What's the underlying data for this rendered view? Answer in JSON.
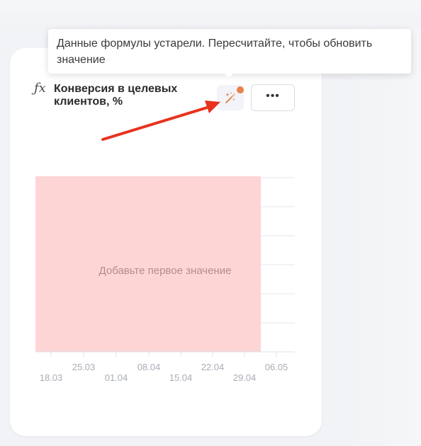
{
  "tooltip": {
    "text": "Данные формулы устарели. Пересчитайте, чтобы обновить значение"
  },
  "card": {
    "title": "Конверсия в целевых клиентов, %",
    "fx_icon": "fx-icon",
    "formula_icon": "magic-wand-icon",
    "more_label": "•••",
    "stale_color": "#e9824a"
  },
  "chart_data": {
    "type": "bar",
    "placeholder": "Добавьте первое значение",
    "x_ticks_upper": [
      "25.03",
      "08.04",
      "22.04",
      "06.05"
    ],
    "x_ticks_lower": [
      "18.03",
      "01.04",
      "15.04",
      "29.04"
    ],
    "series": [],
    "grid": true,
    "overlay_color": "#fdd5d5"
  },
  "annotation": {
    "arrow_color": "#e8321e"
  }
}
